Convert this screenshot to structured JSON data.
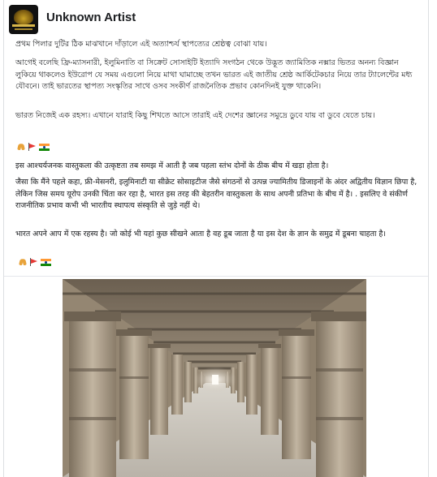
{
  "post": {
    "author": "Unknown Artist",
    "avatar_icon": "page-avatar-icon",
    "paragraphs": [
      "প্রথম পিলার দুটির ঠিক মাঝখানে দাঁড়ালে এই অত্যাশ্চর্য স্থাপত্যের শ্রেষ্ঠত্ব বোঝা যায়।",
      "আগেই বলেছি ফ্রি-ম্যাসনারী, ইলুমিনাতি বা সিক্রেট সোসাইটি ইত্যাদি সংগঠন থেকে উদ্ভূত জ্যামিতিক নক্সার ভিতর অনন্য বিজ্ঞান লুকিয়ে থাকলেও ইউরোপ যে সময় এগুলো নিয়ে মাথা ঘামাচ্ছে তখন ভারত এই জাতীয় শ্রেষ্ঠ আর্কিটেকচার নিয়ে তার ট্যালেন্টের মধ্য যৌবনে। তাই ভারতের স্থাপত্য সংস্কৃতির সাথে ওসব সংকীর্ণ রাজনৈতিক প্রভাব কোনদিনই যুক্ত থাকেনি।",
      "ভারত নিজেই এক রহস্য। এখানে যারাই কিছু শিখতে আসে তারাই এই দেশের জ্ঞানের সমুদ্রে ডুবে যায় বা ডুবে যেতে চায়।",
      "इस आश्चर्यजनक वास्तुकला की उत्कृष्टता तब समझ में आती है जब पहला स्तंभ दोनों के ठीक बीच में खड़ा होता है।",
      " जैसा कि मैंने पहले कहा, फ्री-मेसनरी, इलुमिनाटी या सीक्रेट सोसाइटीज जैसे संगठनों से उत्पन्न ज्यामितीय डिजाइनों के अंदर अद्वितीय विज्ञान छिपा है, लेकिन जिस समय यूरोप उनकी चिंता कर रहा है, भारत इस तरह की बेहतरीन वास्तुकला के साथ अपनी प्रतिभा के बीच में है। .  इसलिए वे संकीर्ण राजनीतिक प्रभाव कभी भी भारतीय स्थापत्य संस्कृति से जुड़े नहीं थे।",
      " भारत अपने आप में एक रहस्य है।  जो कोई भी यहां कुछ सीखने आता है वह डूब जाता है या इस देश के ज्ञान के समुद्र में डूबना चाहता है।"
    ],
    "emoji_rows": [
      [
        "folded-hands-icon",
        "triangular-flag-icon",
        "india-flag-icon"
      ],
      [
        "folded-hands-icon",
        "triangular-flag-icon",
        "india-flag-icon"
      ]
    ],
    "photo": {
      "subject": "long stone pillared corridor photo",
      "colors": {
        "stone": "#a99b87",
        "shadow": "#5c5245",
        "floor": "#c7c2ba",
        "light": "#f2ede4"
      }
    }
  }
}
